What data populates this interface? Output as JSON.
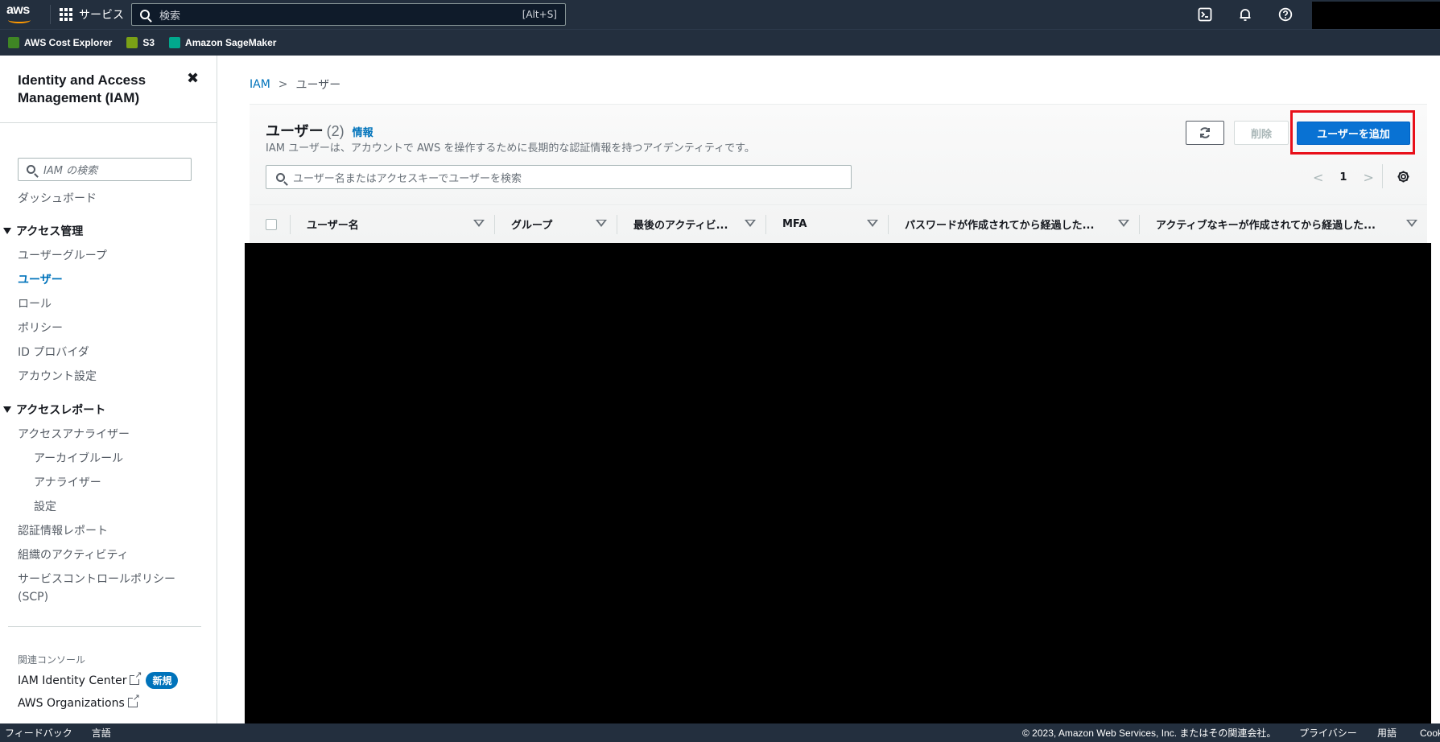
{
  "topnav": {
    "logo": "aws",
    "services_label": "サービス",
    "search_placeholder": "検索",
    "search_shortcut": "[Alt+S]",
    "icons": [
      "cloudshell-icon",
      "bell-icon",
      "help-icon"
    ]
  },
  "favorites": [
    {
      "label": "AWS Cost Explorer",
      "color": "#3f8624"
    },
    {
      "label": "S3",
      "color": "#7aa116"
    },
    {
      "label": "Amazon SageMaker",
      "color": "#01a88d"
    }
  ],
  "sidebar": {
    "title": "Identity and Access Management (IAM)",
    "search_placeholder": "IAM の検索",
    "dashboard": "ダッシュボード",
    "section_access": "アクセス管理",
    "access_items": [
      "ユーザーグループ",
      "ユーザー",
      "ロール",
      "ポリシー",
      "ID プロバイダ",
      "アカウント設定"
    ],
    "section_reports": "アクセスレポート",
    "reports": {
      "analyzer": "アクセスアナライザー",
      "analyzer_sub": [
        "アーカイブルール",
        "アナライザー",
        "設定"
      ],
      "credential_report": "認証情報レポート",
      "org_activity": "組織のアクティビティ",
      "scp": "サービスコントロールポリシー (SCP)"
    },
    "related_label": "関連コンソール",
    "identity_center": "IAM Identity Center",
    "new_badge": "新規",
    "organizations": "AWS Organizations"
  },
  "breadcrumb": {
    "root": "IAM",
    "current": "ユーザー"
  },
  "panel": {
    "title": "ユーザー",
    "count": "(2)",
    "info": "情報",
    "description": "IAM ユーザーは、アカウントで AWS を操作するために長期的な認証情報を持つアイデンティティです。",
    "delete_label": "削除",
    "add_label": "ユーザーを追加",
    "search_placeholder": "ユーザー名またはアクセスキーでユーザーを検索",
    "page": "1"
  },
  "table": {
    "columns": [
      "ユーザー名",
      "グループ",
      "最後のアクティビ...",
      "MFA",
      "パスワードが作成されてから経過した...",
      "アクティブなキーが作成されてから経過した..."
    ]
  },
  "footer": {
    "feedback": "フィードバック",
    "language": "言語",
    "copyright": "© 2023, Amazon Web Services, Inc. またはその関連会社。",
    "privacy": "プライバシー",
    "terms": "用語",
    "cookie": "Cookie"
  }
}
